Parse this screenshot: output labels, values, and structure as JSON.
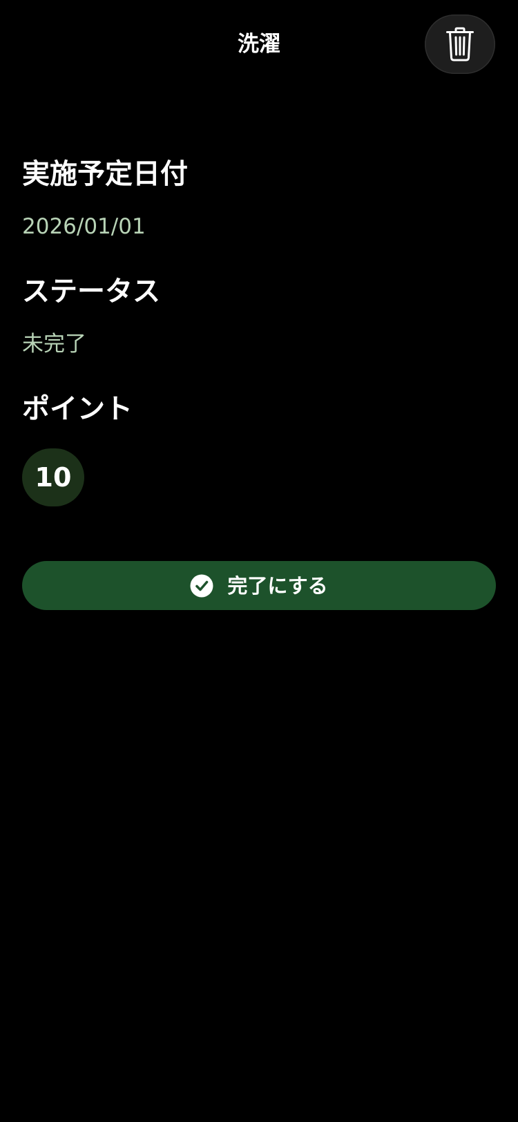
{
  "header": {
    "title": "洗濯",
    "delete_icon": "trash-icon"
  },
  "sections": {
    "scheduled_date": {
      "label": "実施予定日付",
      "value": "2026/01/01"
    },
    "status": {
      "label": "ステータス",
      "value": "未完了"
    },
    "points": {
      "label": "ポイント",
      "value": "10"
    }
  },
  "actions": {
    "complete_label": "完了にする",
    "complete_icon": "check-circle-icon"
  },
  "colors": {
    "background": "#000000",
    "value_text": "#b8d3b6",
    "points_badge": "#1c3119",
    "primary_button": "#1d522b"
  }
}
